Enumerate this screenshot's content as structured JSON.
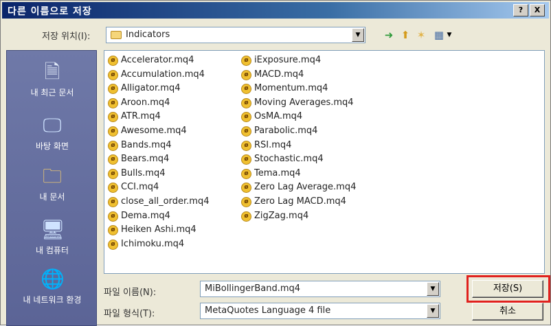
{
  "window": {
    "title": "다른 이름으로 저장",
    "help_label": "?",
    "close_label": "X"
  },
  "toolbar": {
    "savein_label": "저장 위치(I):",
    "savein_value": "Indicators",
    "back_icon": "back-arrow-icon",
    "up_icon": "up-folder-icon",
    "newfolder_icon": "new-folder-icon",
    "views_icon": "views-menu-icon"
  },
  "places": [
    {
      "label": "내 최근 문서",
      "icon": "recent-documents-icon"
    },
    {
      "label": "바탕 화면",
      "icon": "desktop-icon"
    },
    {
      "label": "내 문서",
      "icon": "my-documents-icon"
    },
    {
      "label": "내 컴퓨터",
      "icon": "my-computer-icon"
    },
    {
      "label": "내 네트워크 환경",
      "icon": "network-icon"
    }
  ],
  "files": {
    "column1": [
      "Accelerator.mq4",
      "Accumulation.mq4",
      "Alligator.mq4",
      "Aroon.mq4",
      "ATR.mq4",
      "Awesome.mq4",
      "Bands.mq4",
      "Bears.mq4",
      "Bulls.mq4",
      "CCI.mq4",
      "close_all_order.mq4",
      "Dema.mq4",
      "Heiken Ashi.mq4",
      "Ichimoku.mq4"
    ],
    "column2": [
      "iExposure.mq4",
      "MACD.mq4",
      "Momentum.mq4",
      "Moving Averages.mq4",
      "OsMA.mq4",
      "Parabolic.mq4",
      "RSI.mq4",
      "Stochastic.mq4",
      "Tema.mq4",
      "Zero Lag Average.mq4",
      "Zero Lag MACD.mq4",
      "ZigZag.mq4"
    ]
  },
  "form": {
    "filename_label": "파일 이름(N):",
    "filename_value": "MiBollingerBand.mq4",
    "filetype_label": "파일 형식(T):",
    "filetype_value": "MetaQuotes Language 4 file"
  },
  "buttons": {
    "save_label": "저장(S)",
    "cancel_label": "취소"
  },
  "colors": {
    "highlight": "#e0211d",
    "places_bg": "#6f79a8"
  }
}
